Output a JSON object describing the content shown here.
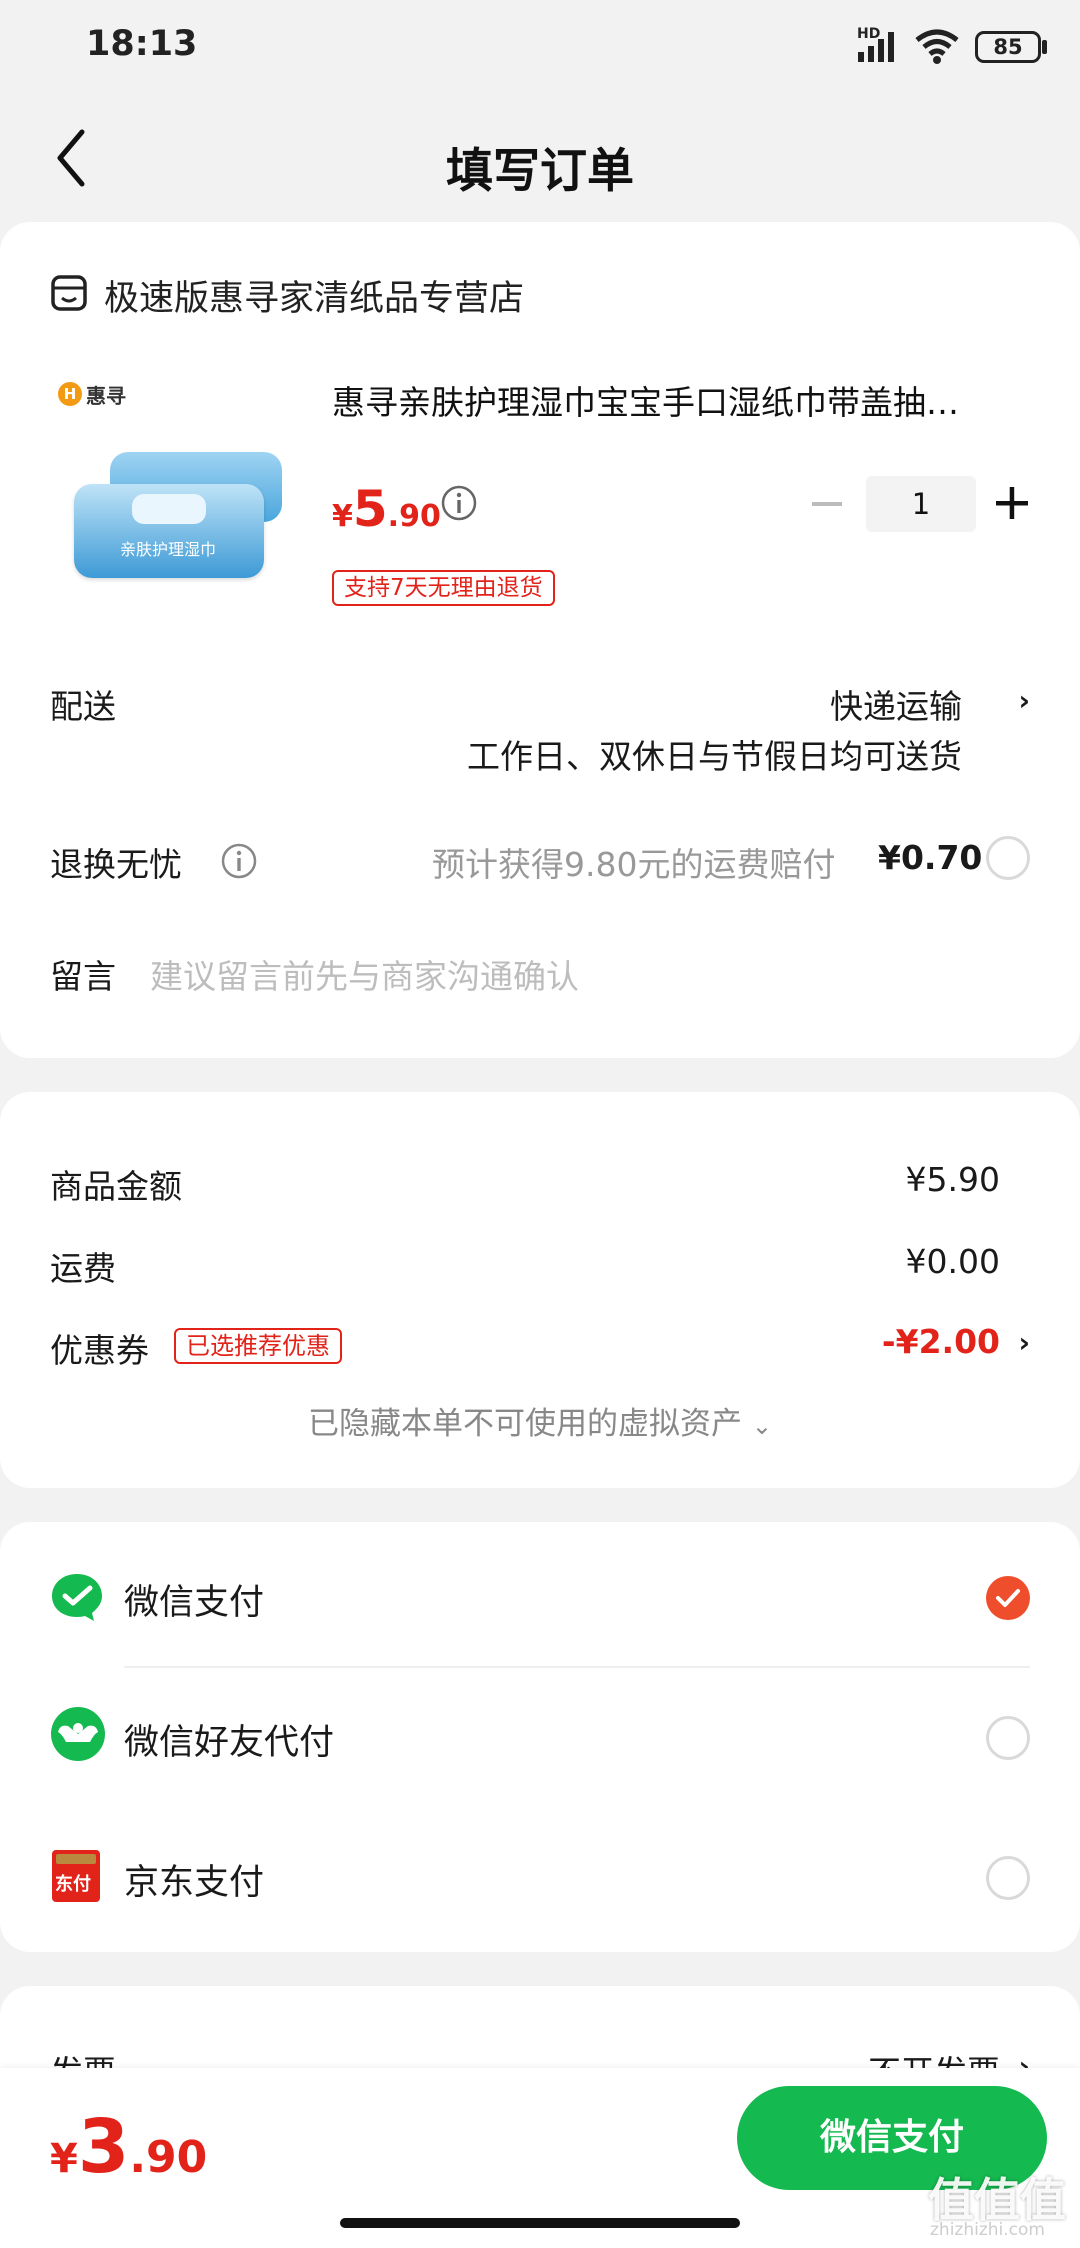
{
  "status_bar": {
    "time": "18:13",
    "network": "HD",
    "battery": "85"
  },
  "header": {
    "title": "填写订单"
  },
  "store": {
    "name": "极速版惠寻家清纸品专营店"
  },
  "product": {
    "title": "惠寻亲肤护理湿巾宝宝手口湿纸巾带盖抽…",
    "price_symbol": "¥",
    "price_int": "5",
    "price_dec": ".90",
    "quantity": "1",
    "return_tag": "支持7天无理由退货",
    "image_brand": "惠寻",
    "package_label": "亲肤护理湿巾"
  },
  "delivery": {
    "label": "配送",
    "method": "快递运输",
    "note": "工作日、双休日与节假日均可送货"
  },
  "return_insurance": {
    "label": "退换无忧",
    "desc": "预计获得9.80元的运费赔付",
    "price": "¥0.70"
  },
  "message": {
    "label": "留言",
    "placeholder": "建议留言前先与商家沟通确认"
  },
  "summary": {
    "goods_label": "商品金额",
    "goods_value": "¥5.90",
    "shipping_label": "运费",
    "shipping_value": "¥0.00",
    "coupon_label": "优惠券",
    "coupon_tag": "已选推荐优惠",
    "coupon_value": "-¥2.00",
    "hidden_assets": "已隐藏本单不可使用的虚拟资产"
  },
  "payment": {
    "options": [
      {
        "label": "微信支付",
        "selected": true
      },
      {
        "label": "微信好友代付",
        "selected": false
      },
      {
        "label": "京东支付",
        "selected": false
      }
    ],
    "jd_icon_text": "东付"
  },
  "invoice": {
    "label": "发票",
    "value": "不开发票"
  },
  "bottom": {
    "price_symbol": "¥",
    "price_int": "3",
    "price_dec": ".90",
    "pay_button": "微信支付"
  },
  "watermark": {
    "text": "值值值",
    "url": "zhizhizhi.com"
  },
  "colors": {
    "accent_red": "#e2231a",
    "wechat_green": "#14b94f",
    "radio_selected": "#ef4e2c"
  }
}
